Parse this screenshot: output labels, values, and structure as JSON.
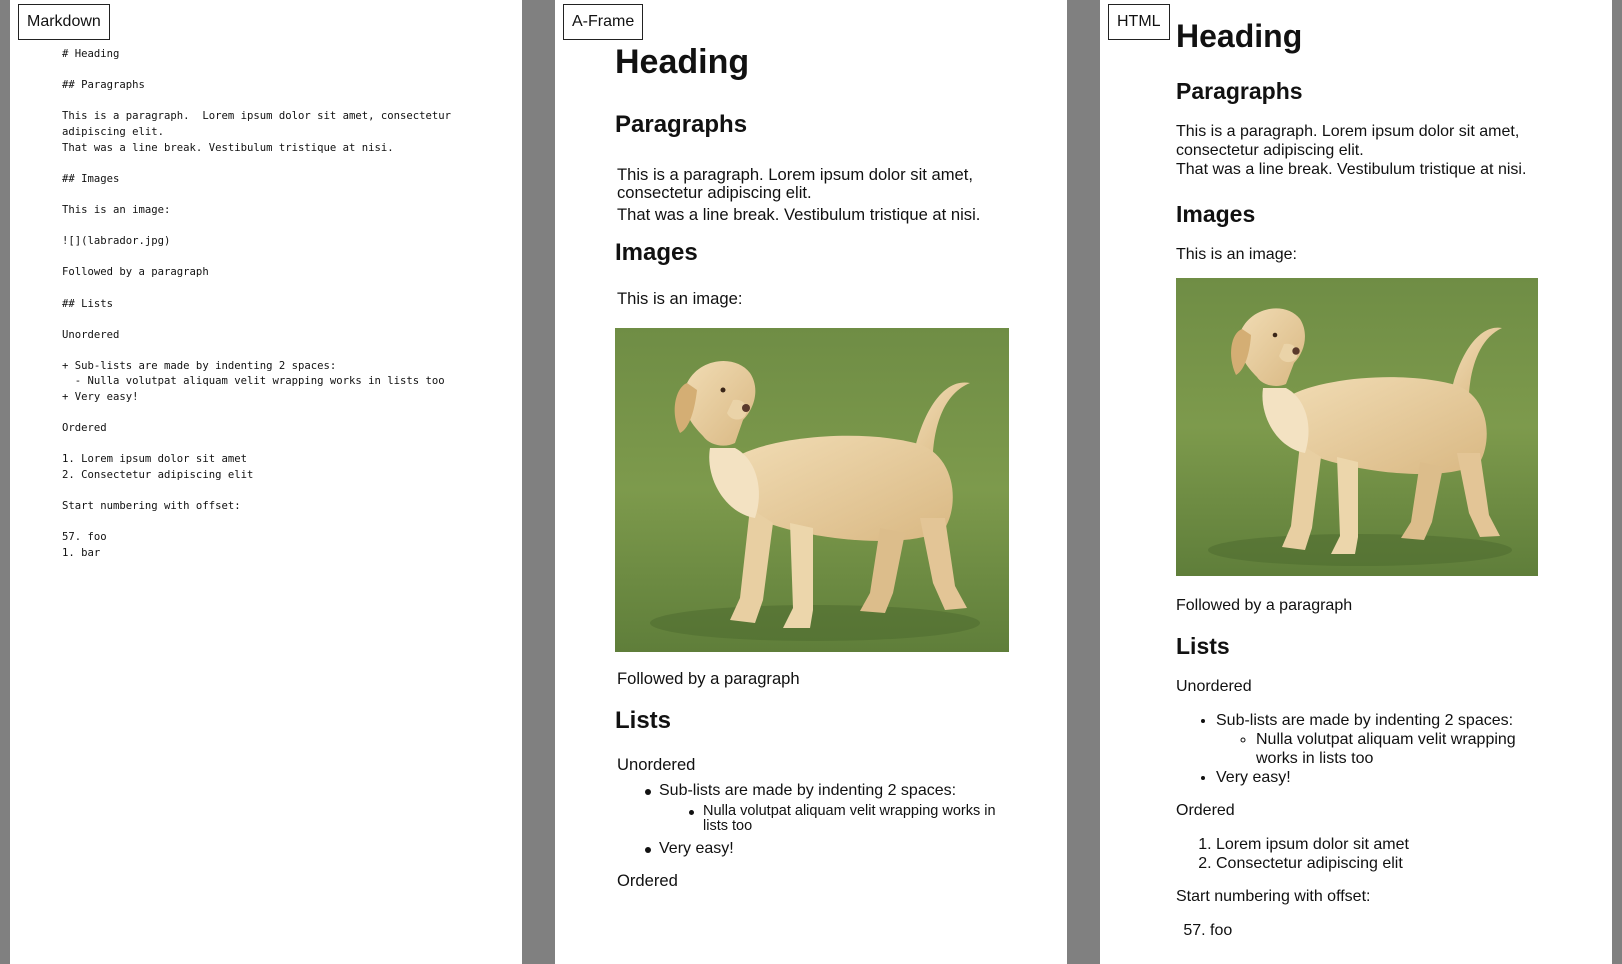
{
  "tabs": {
    "markdown": "Markdown",
    "aframe": "A-Frame",
    "html": "HTML"
  },
  "markdown_source": "# Heading\n\n## Paragraphs\n\nThis is a paragraph.  Lorem ipsum dolor sit amet, consectetur\nadipiscing elit.\nThat was a line break. Vestibulum tristique at nisi.\n\n## Images\n\nThis is an image:\n\n![](labrador.jpg)\n\nFollowed by a paragraph\n\n## Lists\n\nUnordered\n\n+ Sub-lists are made by indenting 2 spaces:\n  - Nulla volutpat aliquam velit wrapping works in lists too\n+ Very easy!\n\nOrdered\n\n1. Lorem ipsum dolor sit amet\n2. Consectetur adipiscing elit\n\nStart numbering with offset:\n\n57. foo\n1. bar",
  "doc": {
    "heading": "Heading",
    "paragraphs_heading": "Paragraphs",
    "paragraph_line1": "This is a paragraph.  Lorem ipsum dolor sit amet, consectetur adipiscing elit.",
    "paragraph_line2": "That was a line break. Vestibulum tristique at nisi.",
    "images_heading": "Images",
    "image_intro": "This is an image:",
    "image_subject": "labrador dog standing on grass",
    "followed": "Followed by a paragraph",
    "lists_heading": "Lists",
    "unordered_label": "Unordered",
    "ul_item1": "Sub-lists are made by indenting 2 spaces:",
    "ul_sub_item1": "Nulla volutpat aliquam velit wrapping works in lists too",
    "ul_item2": "Very easy!",
    "ordered_label": "Ordered",
    "ol_item1": "Lorem ipsum dolor sit amet",
    "ol_item2": "Consectetur adipiscing elit",
    "offset_label": "Start numbering with offset:",
    "offset_item1": "foo"
  }
}
